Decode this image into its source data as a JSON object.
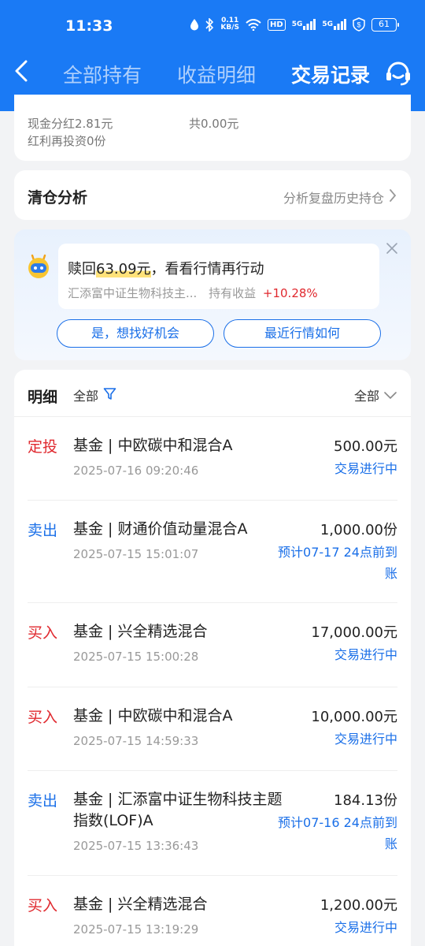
{
  "status_bar": {
    "time": "11:33",
    "speed_top": "0.11",
    "speed_unit": "KB/S",
    "hd": "HD",
    "signal1": "5G",
    "signal2": "5G",
    "battery": "61"
  },
  "header": {
    "tabs": [
      {
        "label": "全部持有",
        "active": false
      },
      {
        "label": "收益明细",
        "active": false
      },
      {
        "label": "交易记录",
        "active": true
      }
    ],
    "accent_color": "#1a7af5"
  },
  "summary": {
    "cash_dividend": "现金分红2.81元",
    "total": "共0.00元",
    "reinvest": "红利再投资0份"
  },
  "clearance": {
    "title": "清仓分析",
    "subtitle": "分析复盘历史持仓"
  },
  "promo": {
    "msg_prefix": "赎回",
    "msg_amount": "63.09元",
    "msg_suffix": "，看看行情再行动",
    "fund": "汇添富中证生物科技主...",
    "holding_label": "持有收益",
    "holding_pct": "+10.28%",
    "button_left": "是，想找好机会",
    "button_right": "最近行情如何"
  },
  "list": {
    "title": "明细",
    "filter_label": "全部",
    "right_label": "全部",
    "rows": [
      {
        "type": "定投",
        "kind": "buy",
        "name": "基金 | 中欧碳中和混合A",
        "date": "2025-07-16 09:20:46",
        "amount": "500.00元",
        "status": "交易进行中"
      },
      {
        "type": "卖出",
        "kind": "sell",
        "name": "基金 | 财通价值动量混合A",
        "date": "2025-07-15 15:01:07",
        "amount": "1,000.00份",
        "status": "预计07-17 24点前到账"
      },
      {
        "type": "买入",
        "kind": "buy",
        "name": "基金 | 兴全精选混合",
        "date": "2025-07-15 15:00:28",
        "amount": "17,000.00元",
        "status": "交易进行中"
      },
      {
        "type": "买入",
        "kind": "buy",
        "name": "基金 | 中欧碳中和混合A",
        "date": "2025-07-15 14:59:33",
        "amount": "10,000.00元",
        "status": "交易进行中"
      },
      {
        "type": "卖出",
        "kind": "sell",
        "name": "基金 | 汇添富中证生物科技主题指数(LOF)A",
        "date": "2025-07-15 13:36:43",
        "amount": "184.13份",
        "status": "预计07-16 24点前到账"
      },
      {
        "type": "买入",
        "kind": "buy",
        "name": "基金 | 兴全精选混合",
        "date": "2025-07-15 13:19:29",
        "amount": "1,200.00元",
        "status": "交易进行中"
      }
    ]
  }
}
